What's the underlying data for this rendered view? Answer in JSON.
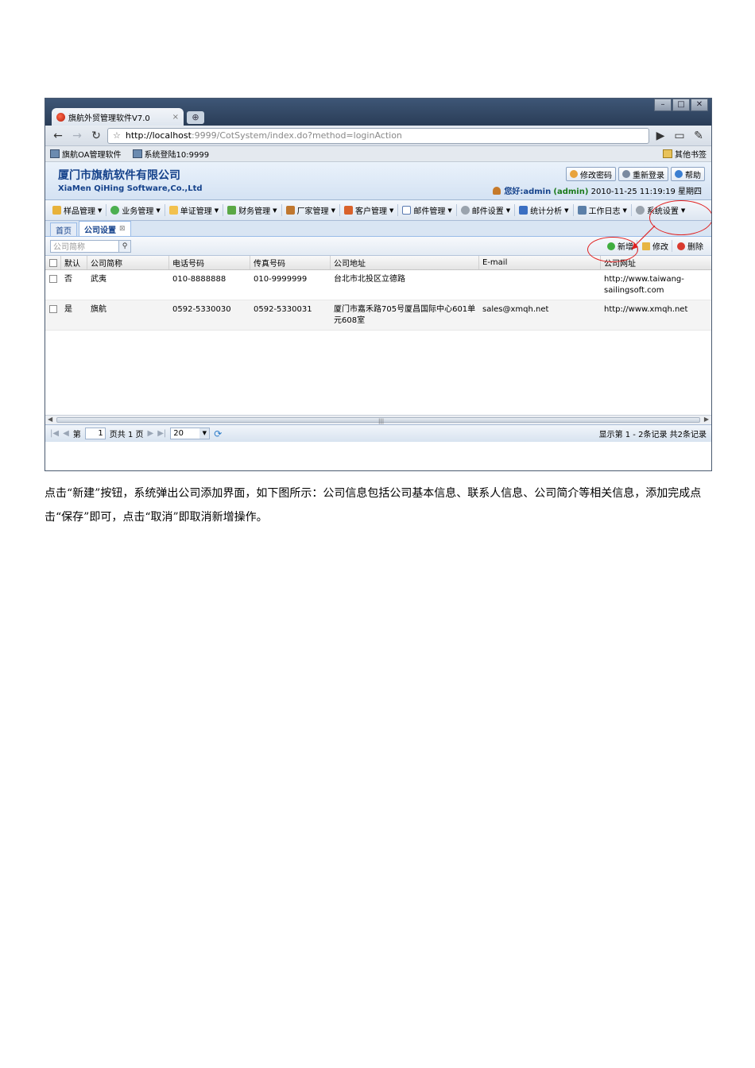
{
  "browser": {
    "tab_title": "旗航外贸管理软件V7.0",
    "tab_close": "×",
    "new_tab": "⊕",
    "url_host": "http://localhost",
    "url_rest": ":9999/CotSystem/index.do?method=loginAction",
    "bookmarks": [
      "旗航OA管理软件",
      "系统登陆10:9999"
    ],
    "other_bookmarks": "其他书签"
  },
  "app": {
    "company_cn": "厦门市旗航软件有限公司",
    "company_en": "XiaMen QiHing Software,Co.,Ltd",
    "header_buttons": [
      "修改密码",
      "重新登录",
      "帮助"
    ],
    "greeting": "您好:admin",
    "greeting_user": "(admin)",
    "datetime": "2010-11-25 11:19:19 星期四"
  },
  "menu": [
    "样品管理",
    "业务管理",
    "单证管理",
    "财务管理",
    "厂家管理",
    "客户管理",
    "邮件管理",
    "邮件设置",
    "统计分析",
    "工作日志",
    "系统设置"
  ],
  "tabs": [
    {
      "label": "首页"
    },
    {
      "label": "公司设置"
    }
  ],
  "toolbar": {
    "search_placeholder": "公司简称",
    "buttons": [
      "新增",
      "修改",
      "删除"
    ]
  },
  "grid": {
    "columns": [
      "默认",
      "公司简称",
      "电话号码",
      "传真号码",
      "公司地址",
      "E-mail",
      "公司网址"
    ],
    "rows": [
      [
        "否",
        "武夷",
        "010-8888888",
        "010-9999999",
        "台北市北投区立德路",
        "",
        "http://www.taiwang-sailingsoft.com"
      ],
      [
        "是",
        "旗航",
        "0592-5330030",
        "0592-5330031",
        "厦门市嘉禾路705号厦昌国际中心601单元608室",
        "sales@xmqh.net",
        "http://www.xmqh.net"
      ]
    ]
  },
  "paging": {
    "page_prefix": "第",
    "page_value": "1",
    "page_suffix": "页共 1 页",
    "page_size": "20",
    "info": "显示第 1 - 2条记录 共2条记录"
  },
  "paragraph": "点击“新建”按钮，系统弹出公司添加界面，如下图所示：公司信息包括公司基本信息、联系人信息、公司简介等相关信息，添加完成点击“保存”即可，点击“取消”即取消新增操作。",
  "colors": {
    "annotation": "#e02020",
    "header_blue": "#15428b"
  }
}
